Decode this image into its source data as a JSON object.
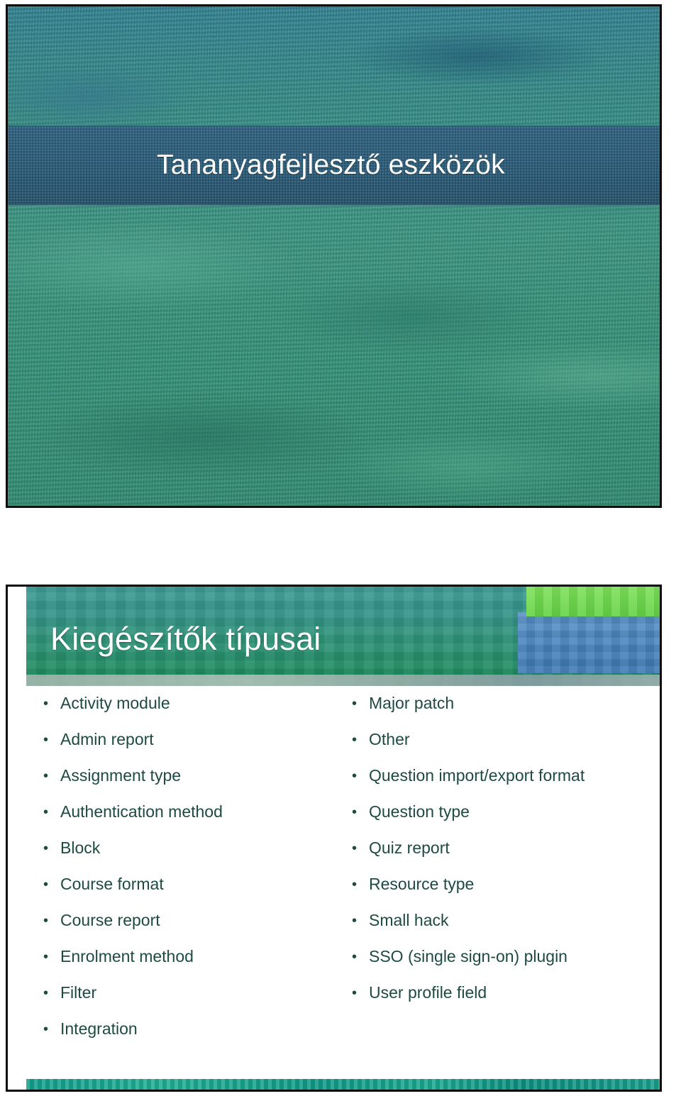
{
  "slides": [
    {
      "id": "title-slide",
      "title": "Tananyagfejlesztő eszközök"
    },
    {
      "id": "plugin-types-slide",
      "title": "Kiegészítők típusai",
      "bullet_marker": "•",
      "left_column": [
        "Activity module",
        "Admin report",
        "Assignment type",
        "Authentication method",
        "Block",
        "Course format",
        "Course report",
        "Enrolment method",
        "Filter",
        "Integration"
      ],
      "right_column": [
        "Major patch",
        "Other",
        "Question import/export format",
        "Question type",
        "Quiz report",
        "Resource type",
        "Small hack",
        "SSO (single sign-on) plugin",
        "User profile field"
      ]
    }
  ],
  "colors": {
    "title_band": "#2a5c79",
    "title_text": "#ffffff",
    "header_teal": "#36907f",
    "header_blue": "#4a84be",
    "header_green": "#6fd84a",
    "bullet_text": "#1e4a42",
    "footer_strip": "#17a08a",
    "slide_border": "#0d0d0d"
  }
}
